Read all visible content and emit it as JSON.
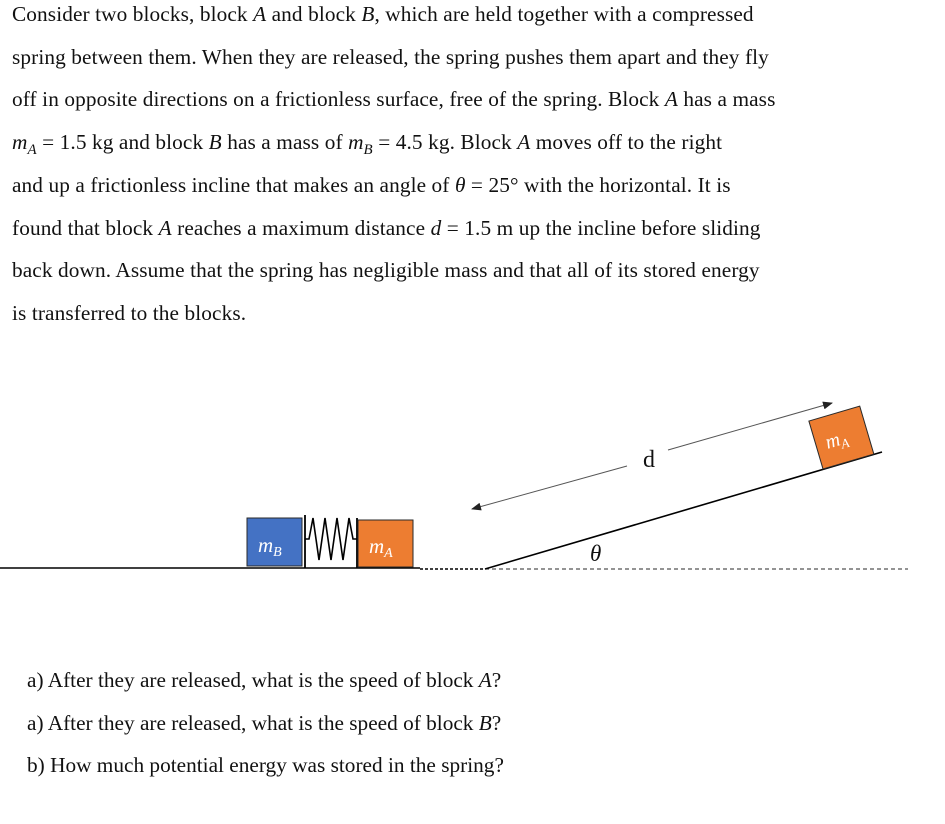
{
  "problem": {
    "lines": [
      [
        "Consider two blocks, block ",
        {
          "it": "A"
        },
        " and block ",
        {
          "it": "B"
        },
        ", which are held together with a compressed"
      ],
      [
        "spring between them. When they are released, the spring pushes them apart and they fly"
      ],
      [
        "off in opposite directions on a frictionless surface, free of the spring. Block ",
        {
          "it": "A"
        },
        " has a mass"
      ],
      [
        {
          "it": "m"
        },
        {
          "sub": "A"
        },
        " = 1.5 kg and block ",
        {
          "it": "B"
        },
        " has a mass of ",
        {
          "it": "m"
        },
        {
          "sub": "B"
        },
        " = 4.5 kg. Block ",
        {
          "it": "A"
        },
        " moves off to the right"
      ],
      [
        "and up a frictionless incline that makes an angle of ",
        {
          "it": "θ"
        },
        " = 25° with the horizontal. It is"
      ],
      [
        "found that block ",
        {
          "it": "A"
        },
        " reaches a maximum distance ",
        {
          "it": "d"
        },
        " = 1.5 m up the incline before sliding"
      ],
      [
        "back down. Assume that the spring has negligible mass and that all of its stored energy"
      ],
      [
        "is transferred to the blocks."
      ]
    ],
    "given": {
      "mass_A_kg": 1.5,
      "mass_B_kg": 4.5,
      "angle_deg": 25,
      "distance_m": 1.5
    }
  },
  "diagram": {
    "block_B_label": "m",
    "block_B_sub": "B",
    "block_A_label": "m",
    "block_A_sub": "A",
    "distance_label": "d",
    "angle_label": "θ",
    "colors": {
      "block_B": "#4472C4",
      "block_A": "#ED7D31",
      "line": "#000000",
      "arrow": "#555555"
    }
  },
  "questions": [
    [
      "a) After they are released, what is the speed of block ",
      {
        "it": "A"
      },
      "?"
    ],
    [
      "a) After they are released, what is the speed of block ",
      {
        "it": "B"
      },
      "?"
    ],
    [
      "b) How much potential energy was stored in the spring?"
    ]
  ]
}
